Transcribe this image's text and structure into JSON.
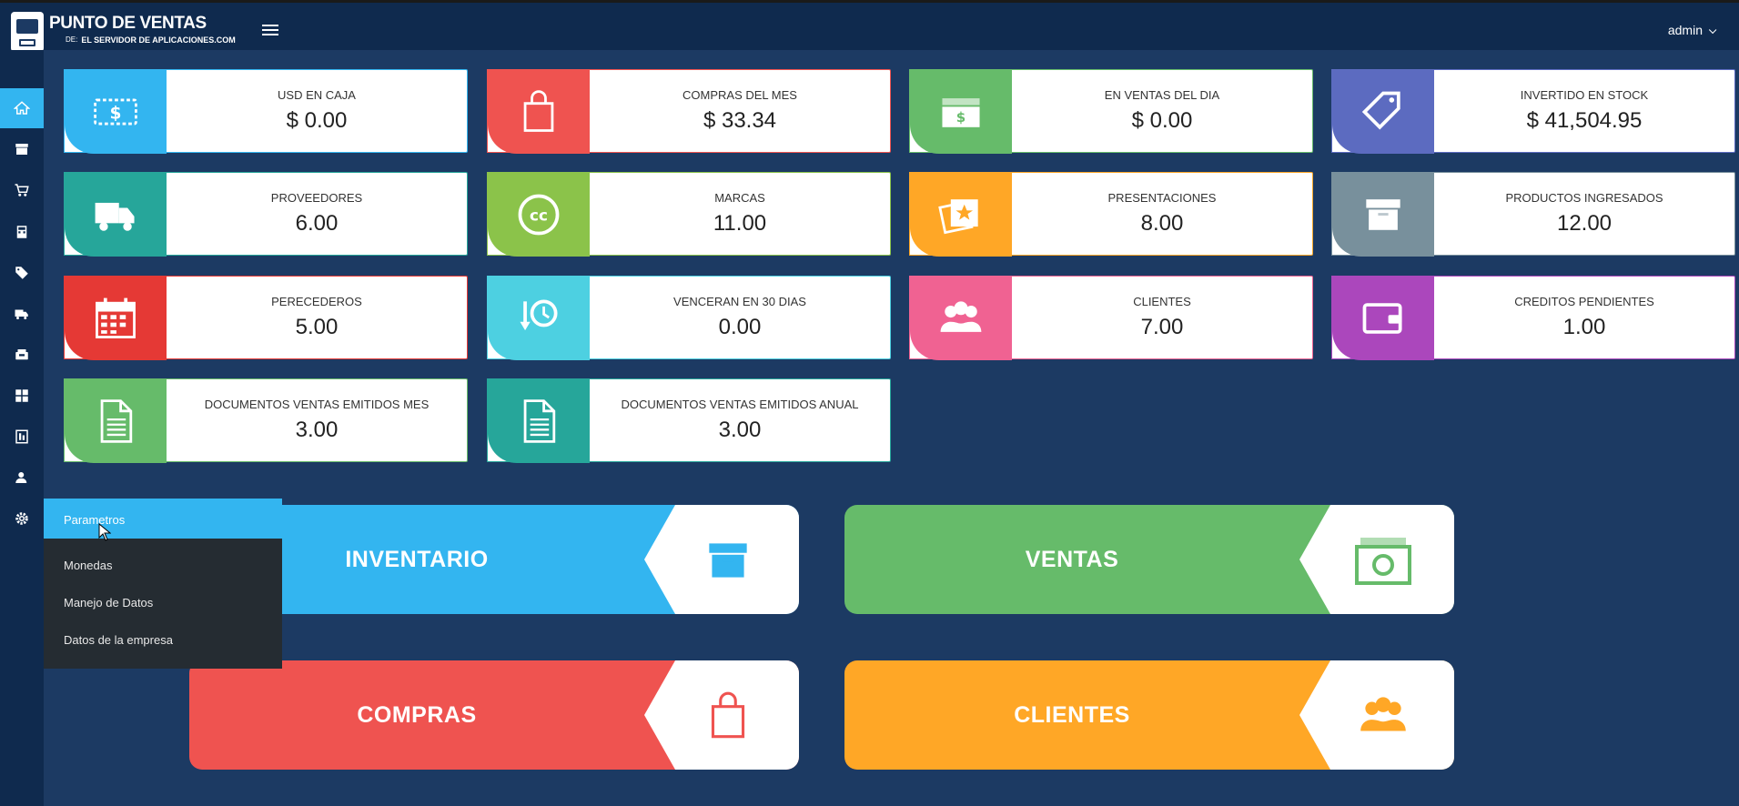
{
  "app": {
    "title": "PUNTO DE VENTAS",
    "subtitle_prefix": "DE:",
    "subtitle_brand": "EL SERVIDOR DE APLICACIONES.COM",
    "user": "admin"
  },
  "sidebar": [
    {
      "icon": "home-icon"
    },
    {
      "icon": "archive-icon"
    },
    {
      "icon": "cart-icon"
    },
    {
      "icon": "calculator-icon"
    },
    {
      "icon": "tags-icon"
    },
    {
      "icon": "truck-icon"
    },
    {
      "icon": "register-icon"
    },
    {
      "icon": "grid-icon"
    },
    {
      "icon": "report-icon"
    },
    {
      "icon": "user-icon"
    },
    {
      "icon": "gear-icon"
    }
  ],
  "cards": [
    {
      "label": "USD EN CAJA",
      "value": "$ 0.00",
      "color": "#33b5f0",
      "icon": "money-icon"
    },
    {
      "label": "COMPRAS DEL MES",
      "value": "$ 33.34",
      "color": "#ef5350",
      "icon": "shopping-bag-icon"
    },
    {
      "label": "EN VENTAS DEL DIA",
      "value": "$ 0.00",
      "color": "#66bb6a",
      "icon": "cash-stack-icon"
    },
    {
      "label": "INVERTIDO EN STOCK",
      "value": "$ 41,504.95",
      "color": "#5c6bc0",
      "icon": "tag-icon"
    },
    {
      "label": "PROVEEDORES",
      "value": "6.00",
      "color": "#26a69a",
      "icon": "truck-icon"
    },
    {
      "label": "MARCAS",
      "value": "11.00",
      "color": "#8bc34a",
      "icon": "cc-icon"
    },
    {
      "label": "PRESENTACIONES",
      "value": "8.00",
      "color": "#ffa726",
      "icon": "photos-icon"
    },
    {
      "label": "PRODUCTOS INGRESADOS",
      "value": "12.00",
      "color": "#78909c",
      "icon": "archive-icon"
    },
    {
      "label": "PERECEDEROS",
      "value": "5.00",
      "color": "#e53935",
      "icon": "calendar-icon"
    },
    {
      "label": "VENCERAN EN 30 DIAS",
      "value": "0.00",
      "color": "#4dd0e1",
      "icon": "history-icon"
    },
    {
      "label": "CLIENTES",
      "value": "7.00",
      "color": "#f06292",
      "icon": "users-icon"
    },
    {
      "label": "CREDITOS PENDIENTES",
      "value": "1.00",
      "color": "#ab47bc",
      "icon": "wallet-icon"
    },
    {
      "label": "DOCUMENTOS VENTAS EMITIDOS MES",
      "value": "3.00",
      "color": "#66bb6a",
      "icon": "document-icon"
    },
    {
      "label": "DOCUMENTOS VENTAS EMITIDOS ANUAL",
      "value": "3.00",
      "color": "#26a69a",
      "icon": "document-icon"
    }
  ],
  "tiles": [
    {
      "label": "INVENTARIO",
      "color": "#33b5f0",
      "icon": "archive-icon"
    },
    {
      "label": "VENTAS",
      "color": "#66bb6a",
      "icon": "cash-icon"
    },
    {
      "label": "COMPRAS",
      "color": "#ef5350",
      "icon": "shopping-bag-icon"
    },
    {
      "label": "CLIENTES",
      "color": "#ffa726",
      "icon": "users-icon"
    }
  ],
  "menu": {
    "header": "Parametros",
    "items": [
      "Monedas",
      "Manejo de Datos",
      "Datos de la empresa"
    ]
  }
}
